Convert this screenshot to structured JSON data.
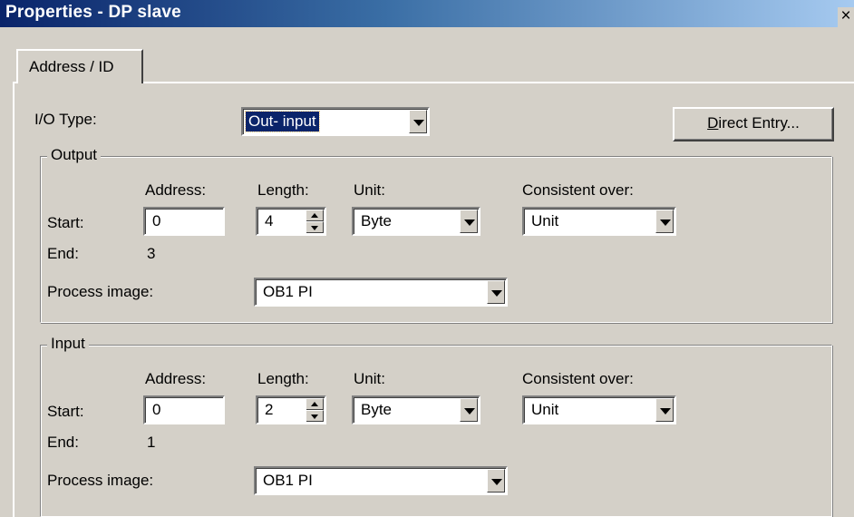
{
  "window": {
    "title": "Properties - DP slave",
    "close_symbol": "×"
  },
  "tabs": [
    {
      "label": "Address / ID",
      "active": true
    }
  ],
  "io_type": {
    "label": "I/O Type:",
    "value": "Out- input"
  },
  "direct_entry_button": {
    "mnemonic": "D",
    "rest": "irect Entry..."
  },
  "output": {
    "title": "Output",
    "col_address": "Address:",
    "col_length": "Length:",
    "col_unit": "Unit:",
    "col_consistent": "Consistent over:",
    "start_label": "Start:",
    "end_label": "End:",
    "address_start": "0",
    "address_end": "3",
    "length": "4",
    "unit": "Byte",
    "consistent_over": "Unit",
    "process_image_label": "Process image:",
    "process_image": "OB1 PI"
  },
  "input": {
    "title": "Input",
    "col_address": "Address:",
    "col_length": "Length:",
    "col_unit": "Unit:",
    "col_consistent": "Consistent over:",
    "start_label": "Start:",
    "end_label": "End:",
    "address_start": "0",
    "address_end": "1",
    "length": "2",
    "unit": "Byte",
    "consistent_over": "Unit",
    "process_image_label": "Process image:",
    "process_image": "OB1 PI"
  },
  "icons": {
    "close": "close-icon",
    "dropdown": "chevron-down-icon",
    "spin_up": "spin-up-icon",
    "spin_down": "spin-down-icon"
  },
  "colors": {
    "titlebar_start": "#0a246a",
    "titlebar_end": "#a6caf0",
    "dialog_bg": "#d4d0c8",
    "selection_bg": "#0a246a"
  }
}
